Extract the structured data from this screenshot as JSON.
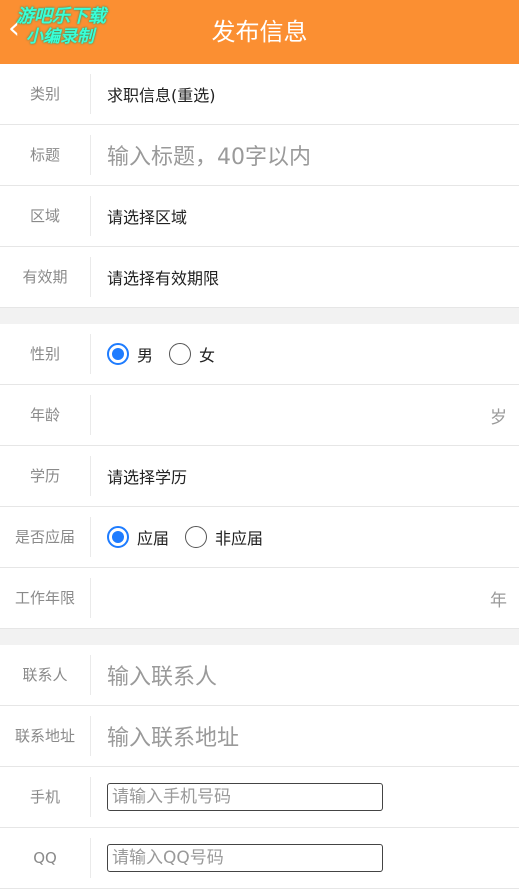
{
  "header": {
    "back_icon": "‹",
    "title": "发布信息",
    "watermark_line1": "游吧乐下载",
    "watermark_line2": "小编录制"
  },
  "section1": {
    "category_label": "类别",
    "category_value": "求职信息(重选)",
    "title_label": "标题",
    "title_placeholder": "输入标题，40字以内",
    "area_label": "区域",
    "area_value": "请选择区域",
    "validity_label": "有效期",
    "validity_value": "请选择有效期限"
  },
  "section2": {
    "gender_label": "性别",
    "gender_options": [
      "男",
      "女"
    ],
    "gender_selected": "男",
    "age_label": "年龄",
    "age_unit": "岁",
    "education_label": "学历",
    "education_value": "请选择学历",
    "graduate_label": "是否应届",
    "graduate_options": [
      "应届",
      "非应届"
    ],
    "graduate_selected": "应届",
    "work_years_label": "工作年限",
    "work_years_unit": "年"
  },
  "section3": {
    "contact_label": "联系人",
    "contact_placeholder": "输入联系人",
    "address_label": "联系地址",
    "address_placeholder": "输入联系地址",
    "phone_label": "手机",
    "phone_placeholder": "请输入手机号码",
    "qq_label": "QQ",
    "qq_placeholder": "请输入QQ号码"
  },
  "colors": {
    "header_bg": "#fb8f32",
    "radio_selected": "#1e7cff"
  }
}
